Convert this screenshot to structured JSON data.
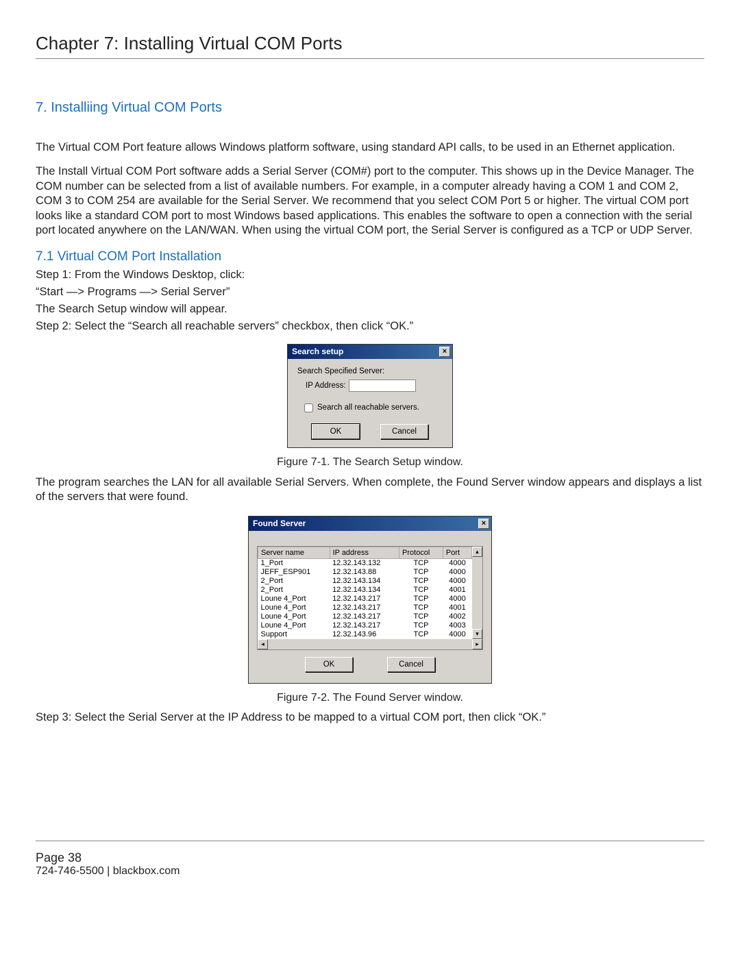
{
  "chapter_title": "Chapter 7: Installing Virtual COM Ports",
  "section_7": "7. Installiing Virtual COM Ports",
  "para1": "The Virtual COM Port feature allows Windows platform software, using standard API calls, to be used in an Ethernet application.",
  "para2": "The Install Virtual COM Port software adds a Serial Server (COM#) port to the computer. This shows up in the Device Manager. The COM number can be selected from a list of available numbers. For example, in a computer already having a COM 1 and COM 2, COM 3 to COM 254 are available for the Serial Server. We recommend that you select COM Port 5 or higher. The virtual COM port looks like a standard COM port to most Windows based applications. This  enables the software to open a connection with the serial port located anywhere on the LAN/WAN. When using the virtual COM port, the Serial Server is configured as a TCP or UDP Server.",
  "section_7_1": "7.1 Virtual COM Port Installation",
  "step1": "Step 1: From the Windows Desktop, click:",
  "step1b": "“Start —> Programs —> Serial Server”",
  "step1c": "The Search Setup window will appear.",
  "step2": "Step 2: Select the “Search all reachable servers” checkbox, then click “OK.”",
  "dialog1": {
    "title": "Search setup",
    "label_specified": "Search Specified Server:",
    "label_ip": "IP Address:",
    "ip_value": "",
    "chk_label": "Search all reachable servers.",
    "ok": "OK",
    "cancel": "Cancel",
    "close_x": "×"
  },
  "caption1": "Figure 7-1. The Search Setup window.",
  "para3": "The program searches the LAN for all available Serial Servers. When complete, the Found Server window appears and displays a list of the servers that were found.",
  "dialog2": {
    "title": "Found Server",
    "close_x": "×",
    "headers": {
      "c1": "Server name",
      "c2": "IP address",
      "c3": "Protocol",
      "c4": "Port"
    },
    "rows": [
      {
        "name": "1_Port",
        "ip": "12.32.143.132",
        "proto": "TCP",
        "port": "4000"
      },
      {
        "name": "JEFF_ESP901",
        "ip": "12.32.143.88",
        "proto": "TCP",
        "port": "4000"
      },
      {
        "name": "2_Port",
        "ip": "12.32.143.134",
        "proto": "TCP",
        "port": "4000"
      },
      {
        "name": "2_Port",
        "ip": "12.32.143.134",
        "proto": "TCP",
        "port": "4001"
      },
      {
        "name": "Loune 4_Port",
        "ip": "12.32.143.217",
        "proto": "TCP",
        "port": "4000"
      },
      {
        "name": "Loune 4_Port",
        "ip": "12.32.143.217",
        "proto": "TCP",
        "port": "4001"
      },
      {
        "name": "Loune 4_Port",
        "ip": "12.32.143.217",
        "proto": "TCP",
        "port": "4002"
      },
      {
        "name": "Loune 4_Port",
        "ip": "12.32.143.217",
        "proto": "TCP",
        "port": "4003"
      },
      {
        "name": "Support",
        "ip": "12.32.143.96",
        "proto": "TCP",
        "port": "4000"
      }
    ],
    "ok": "OK",
    "cancel": "Cancel",
    "arrow_up": "▴",
    "arrow_down": "▾",
    "arrow_left": "◂",
    "arrow_right": "▸"
  },
  "caption2": "Figure 7-2. The Found Server window.",
  "step3": "Step 3: Select the Serial Server at the IP Address to be mapped to a virtual COM port, then click “OK.”",
  "footer": {
    "page": "Page 38",
    "phone": "724-746-5500",
    "divider": "   |   ",
    "site": "blackbox.com"
  }
}
